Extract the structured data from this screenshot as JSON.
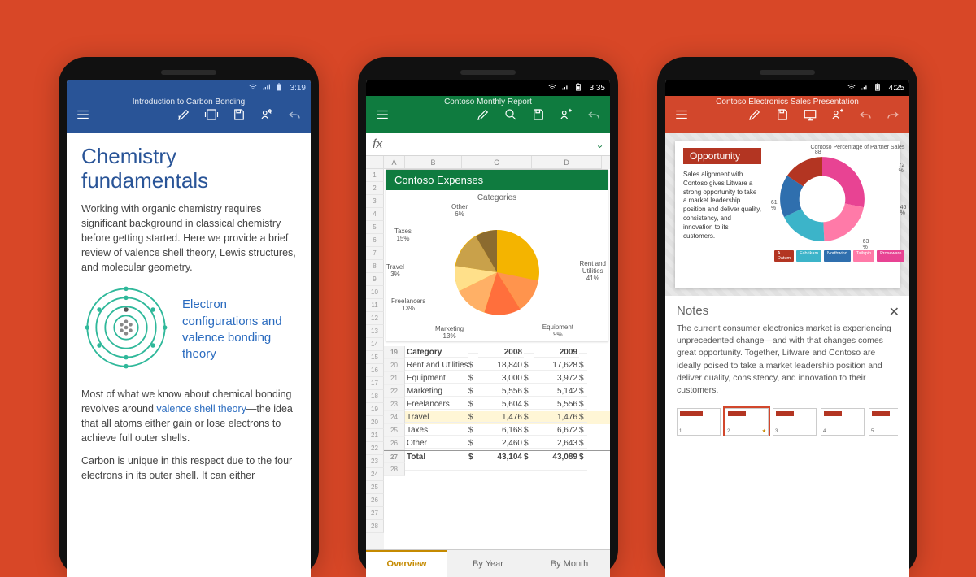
{
  "word": {
    "status_time": "3:19",
    "doc_title": "Introduction to Carbon Bonding",
    "heading": "Chemistry fundamentals",
    "intro": "Working with organic chemistry requires significant background in classical chemistry before getting started. Here we provide a brief review of valence shell theory, Lewis structures, and molecular geometry.",
    "caption": "Electron configurations and valence bonding theory",
    "para2_a": "Most of what we know about chemical bonding revolves around ",
    "link": "valence shell theory",
    "para2_b": "—the idea that all atoms either gain or lose electrons to achieve full outer shells.",
    "para3": "Carbon is unique in this respect due to the four electrons in its outer shell. It can either"
  },
  "excel": {
    "status_time": "3:35",
    "doc_title": "Contoso Monthly Report",
    "fx_label": "fx",
    "col_headers": [
      "",
      "A",
      "B",
      "C",
      "D"
    ],
    "chart_title": "Contoso Expenses",
    "chart_sub": "Categories",
    "table": {
      "header": {
        "cat": "Category",
        "y1": "2008",
        "y2": "2009"
      },
      "rows": [
        {
          "cat": "Rent and Utilities",
          "y1": "18,840",
          "y2": "17,628"
        },
        {
          "cat": "Equipment",
          "y1": "3,000",
          "y2": "3,972"
        },
        {
          "cat": "Marketing",
          "y1": "5,556",
          "y2": "5,142"
        },
        {
          "cat": "Freelancers",
          "y1": "5,604",
          "y2": "5,556"
        },
        {
          "cat": "Travel",
          "y1": "1,476",
          "y2": "1,476"
        },
        {
          "cat": "Taxes",
          "y1": "6,168",
          "y2": "6,672"
        },
        {
          "cat": "Other",
          "y1": "2,460",
          "y2": "2,643"
        }
      ],
      "total": {
        "cat": "Total",
        "y1": "43,104",
        "y2": "43,089"
      }
    },
    "tabs": [
      "Overview",
      "By Year",
      "By Month"
    ],
    "active_tab": "Overview"
  },
  "ppt": {
    "status_time": "4:25",
    "doc_title": "Contoso Electronics Sales Presentation",
    "slide": {
      "opportunity": "Opportunity",
      "para": "Sales alignment with Contoso gives Litware a strong opportunity to take a market leadership position and deliver quality, consistency, and innovation to its customers.",
      "chart_title": "Contoso Percentage of Partner Sales",
      "legend": [
        "A. Datum",
        "Fabrikam",
        "Northwind",
        "Tailspin",
        "Proseware"
      ]
    },
    "notes_title": "Notes",
    "notes": "The current consumer electronics market is experiencing unprecedented change—and with that changes comes great opportunity. Together, Litware and Contoso are ideally poised to take a market leadership position and deliver quality, consistency, and innovation to their customers.",
    "thumbs": [
      1,
      2,
      3,
      4,
      5
    ]
  },
  "chart_data": [
    {
      "app": "excel",
      "type": "pie",
      "title": "Contoso Expenses — Categories",
      "series": [
        {
          "name": "Rent and Utilities",
          "value": 41
        },
        {
          "name": "Equipment",
          "value": 9
        },
        {
          "name": "Marketing",
          "value": 13
        },
        {
          "name": "Freelancers",
          "value": 13
        },
        {
          "name": "Travel",
          "value": 3
        },
        {
          "name": "Taxes",
          "value": 15
        },
        {
          "name": "Other",
          "value": 6
        }
      ]
    },
    {
      "app": "powerpoint",
      "type": "pie",
      "title": "Contoso Percentage of Partner Sales",
      "series": [
        {
          "name": "A. Datum",
          "value": 88
        },
        {
          "name": "Fabrikam",
          "value": 72
        },
        {
          "name": "Northwind",
          "value": 61
        },
        {
          "name": "Tailspin",
          "value": 46
        },
        {
          "name": "Proseware",
          "value": 63
        }
      ],
      "note": "Values are the percentage labels shown around the donut; exact mapping to legend order is approximate."
    }
  ]
}
